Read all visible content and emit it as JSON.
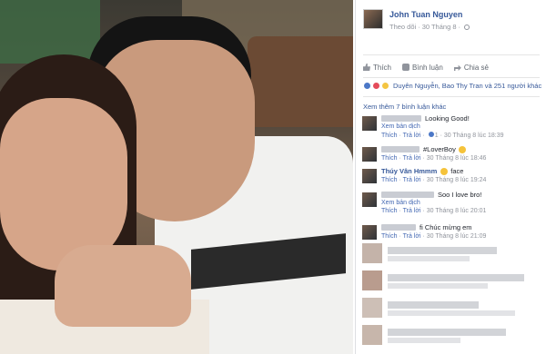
{
  "post": {
    "author": "John Tuan Nguyen",
    "follow_label": "Theo dõi",
    "date": "30 Tháng 8"
  },
  "actions": {
    "like": "Thích",
    "comment": "Bình luận",
    "share": "Chia sẻ"
  },
  "reactions": {
    "text": "Duyên Nguyễn, Bao Thy Tran và 251 người khác"
  },
  "more_comments": "Xem thêm 7 bình luận khác",
  "comments": [
    {
      "name": "",
      "text": "Looking Good!",
      "translate": "Xem bản dịch",
      "like": "Thích",
      "reply": "Trả lời",
      "likes": "1",
      "time": "30 Tháng 8 lúc 18:39"
    },
    {
      "name": "",
      "text": "#LoverBoy",
      "translate": "",
      "like": "Thích",
      "reply": "Trả lời",
      "likes": "",
      "time": "30 Tháng 8 lúc 18:46"
    },
    {
      "name": "Thúy Vân Hmmm",
      "text": "face",
      "translate": "",
      "like": "Thích",
      "reply": "Trả lời",
      "likes": "",
      "time": "30 Tháng 8 lúc 19:24"
    },
    {
      "name": "",
      "text": "Soo I love bro!",
      "translate": "Xem bản dịch",
      "like": "Thích",
      "reply": "Trả lời",
      "likes": "",
      "time": "30 Tháng 8 lúc 20:01"
    },
    {
      "name": "",
      "text": "fi Chúc mừng em",
      "translate": "",
      "like": "Thích",
      "reply": "Trả lời",
      "likes": "",
      "time": "30 Tháng 8 lúc 21:09"
    }
  ],
  "colors": {
    "link": "#365899",
    "meta": "#90949c",
    "like_blue": "#4c78c7",
    "love_red": "#e44c5b"
  }
}
